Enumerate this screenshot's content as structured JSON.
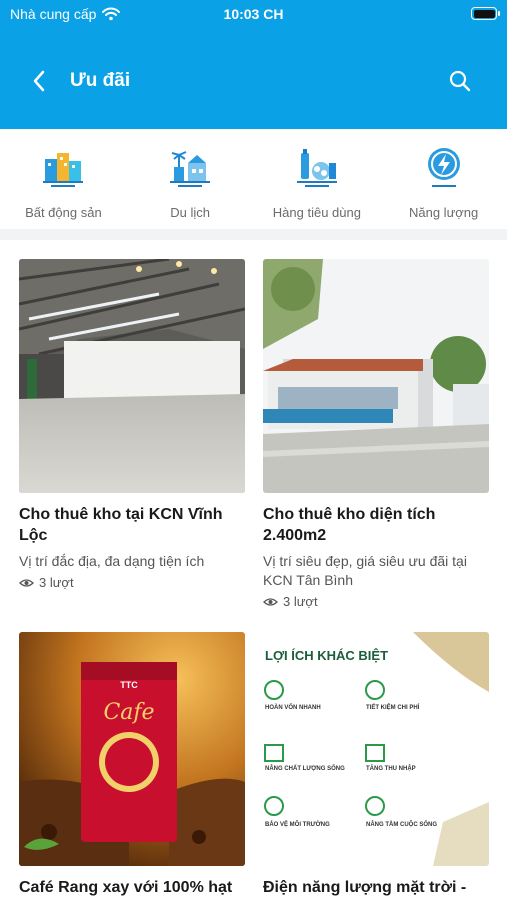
{
  "status_bar": {
    "carrier": "Nhà cung cấp",
    "time": "10:03 CH"
  },
  "navbar": {
    "title": "Ưu đãi"
  },
  "categories": [
    {
      "label": "Bất động sản",
      "icon": "real-estate-icon"
    },
    {
      "label": "Du lịch",
      "icon": "travel-icon"
    },
    {
      "label": "Hàng tiêu dùng",
      "icon": "consumer-goods-icon"
    },
    {
      "label": "Năng lượng",
      "icon": "energy-icon"
    }
  ],
  "offers": [
    {
      "title": "Cho thuê kho tại KCN Vĩnh Lộc",
      "description": "Vị trí đắc địa, đa dạng tiện ích",
      "views": "3 lượt"
    },
    {
      "title": "Cho thuê kho diện tích 2.400m2",
      "description": "Vị trí siêu đẹp, giá siêu ưu đãi tại KCN Tân Bình",
      "views": "3 lượt"
    },
    {
      "title": "Café Rang xay với 100% hạt",
      "package_brand": "TTC",
      "package_title": "Cafe"
    },
    {
      "title": "Điện năng lượng mặt trời -",
      "infographic_heading": "LỢI ÍCH KHÁC BIỆT",
      "infographic_items": [
        "HOÀN VỐN NHANH",
        "TIẾT KIỆM CHI PHÍ",
        "NÂNG CHẤT LƯỢNG SỐNG",
        "TĂNG THU NHẬP",
        "BẢO VỆ MÔI TRƯỜNG",
        "NÂNG TẦM CUỘC SỐNG"
      ]
    }
  ],
  "colors": {
    "header": "#0aa1e6"
  }
}
